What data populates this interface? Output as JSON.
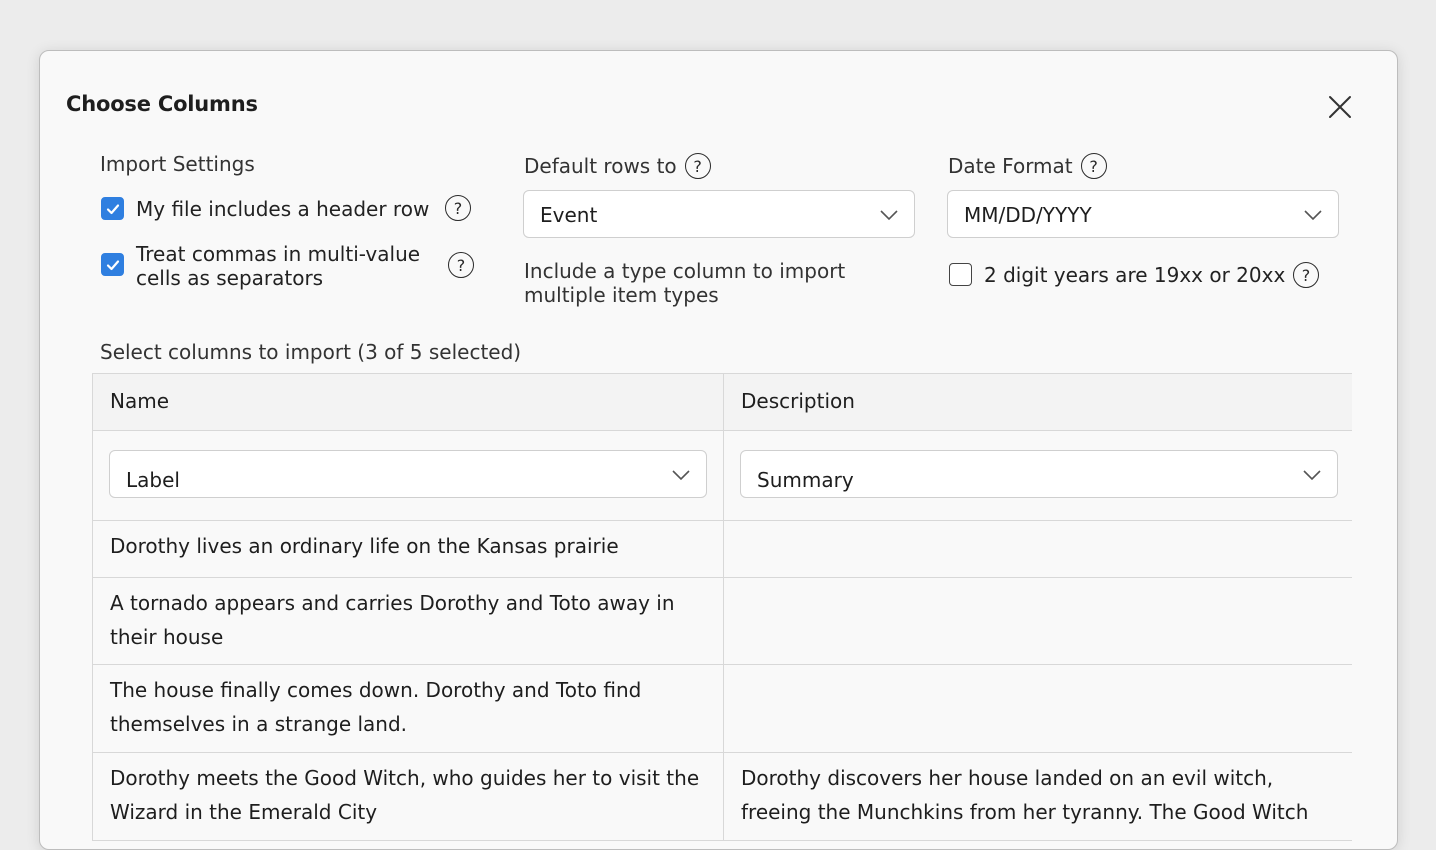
{
  "dialog": {
    "title": "Choose Columns",
    "close_icon": "close-icon"
  },
  "import_settings": {
    "label": "Import Settings",
    "header_row": {
      "checked": true,
      "label": "My file includes a header row"
    },
    "commas_separators": {
      "checked": true,
      "label": "Treat commas in multi-value cells as separators"
    }
  },
  "default_rows": {
    "label": "Default rows to",
    "value": "Event",
    "hint": "Include a type column to import multiple item types"
  },
  "date_format": {
    "label": "Date Format",
    "value": "MM/DD/YYYY",
    "two_digit": {
      "checked": false,
      "label": "2 digit years are 19xx or 20xx"
    }
  },
  "help_glyph": "?",
  "columns": {
    "summary": "Select columns to import (3 of 5 selected)",
    "headers": [
      "Name",
      "Description"
    ],
    "mappings": [
      "Label",
      "Summary"
    ],
    "rows": [
      [
        "Dorothy lives an ordinary life on the Kansas prairie",
        ""
      ],
      [
        "A tornado appears and carries Dorothy and Toto away in their house",
        ""
      ],
      [
        "The house finally comes down. Dorothy and Toto find themselves in a strange land.",
        ""
      ],
      [
        "Dorothy meets the Good Witch, who guides her to visit the Wizard in the Emerald City",
        "Dorothy discovers her house landed on an evil witch, freeing the Munchkins from her tyranny. The Good Witch"
      ]
    ]
  },
  "colors": {
    "accent": "#2f7fe0"
  }
}
